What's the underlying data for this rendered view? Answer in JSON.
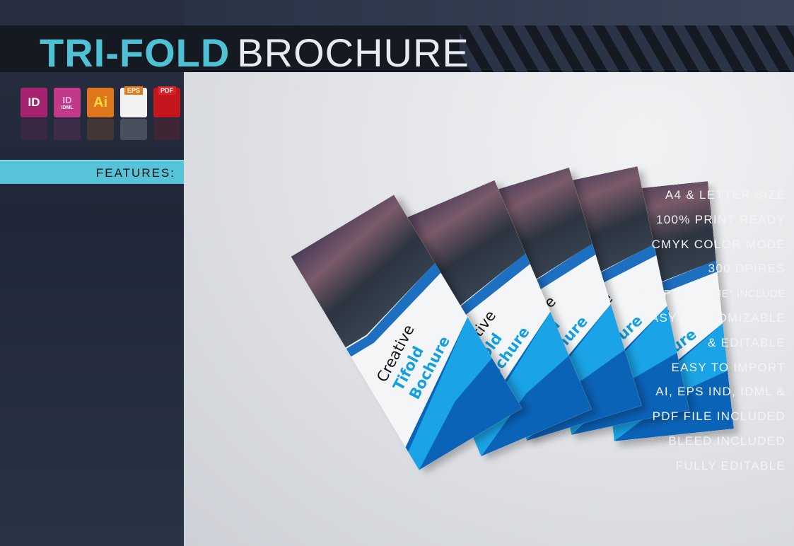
{
  "header": {
    "title_bold": "TRI-FOLD",
    "title_light": "BROCHURE"
  },
  "file_icons": [
    {
      "name": "indesign-icon",
      "label": "ID",
      "color": "#a6246f"
    },
    {
      "name": "idml-icon",
      "label": "ID",
      "sublabel": "IDML",
      "color": "#c2398a"
    },
    {
      "name": "illustrator-icon",
      "label": "Ai",
      "color": "#e0761b"
    },
    {
      "name": "eps-icon",
      "label": "EPS",
      "color": "#f2f2f2"
    },
    {
      "name": "pdf-icon",
      "label": "PDF",
      "color": "#c4161c"
    }
  ],
  "sidebar": {
    "features_label": "FEATURES:",
    "items": [
      "A4 & LETTER SIZE",
      "100% PRINT READY",
      "CMYK COLOR MODE",
      "300 DPIRES",
      "HELP \"READ ME\" INCLUDE",
      "EASY CUSTOMIZABLE",
      "& EDITABLE",
      "EASY TO IMPORT",
      "AI, EPS IND, IDML &",
      "PDF FILE INCLUDED",
      "BLEED INCLUDED",
      "FULLY EDITABLE"
    ]
  },
  "brochure": {
    "line1": "Creative",
    "line2": "Tifold",
    "line3": "Bochure"
  },
  "colors": {
    "accent": "#56c3d8",
    "brochure_blue": "#0b63b8",
    "brochure_cyan": "#1aa3e6"
  }
}
